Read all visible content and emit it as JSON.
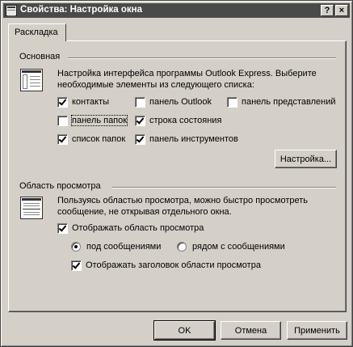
{
  "window": {
    "title": "Свойства: Настройка окна",
    "help_label": "?",
    "close_label": "×"
  },
  "tabs": [
    {
      "label": "Раскладка",
      "active": true
    }
  ],
  "basic_group": {
    "title": "Основная",
    "description": "Настройка интерфейса программы Outlook Express. Выберите необходимые элементы из следующего списка:",
    "checkboxes": [
      {
        "label": "контакты",
        "checked": true
      },
      {
        "label": "панель Outlook",
        "checked": false
      },
      {
        "label": "панель представлений",
        "checked": false
      },
      {
        "label": "панель папок",
        "checked": false
      },
      {
        "label": "строка состояния",
        "checked": true
      },
      {
        "label": "список папок",
        "checked": true
      },
      {
        "label": "панель инструментов",
        "checked": true
      }
    ],
    "customize_button": "Настройка..."
  },
  "preview_group": {
    "title": "Область просмотра",
    "description": "Пользуясь областью просмотра, можно быстро просмотреть сообщение, не открывая отдельного окна.",
    "show_preview": {
      "label": "Отображать область просмотра",
      "checked": true
    },
    "radios": [
      {
        "label": "под сообщениями",
        "checked": true
      },
      {
        "label": "рядом с сообщениями",
        "checked": false
      }
    ],
    "show_header": {
      "label": "Отображать заголовок области просмотра",
      "checked": true
    }
  },
  "buttons": {
    "ok": "OK",
    "cancel": "Отмена",
    "apply": "Применить"
  }
}
